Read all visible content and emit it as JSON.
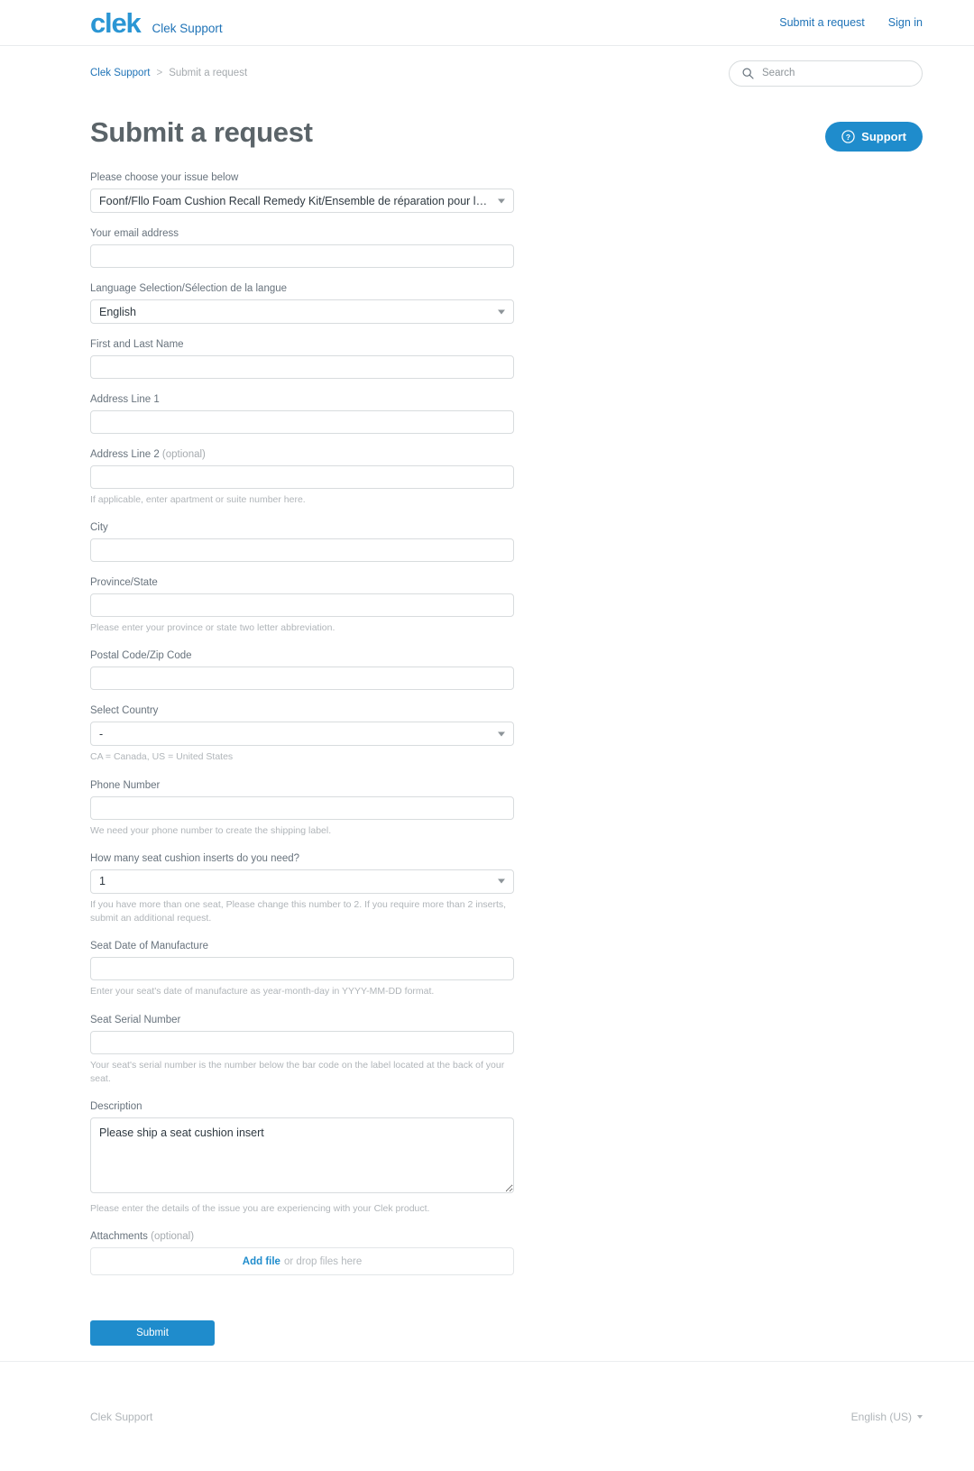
{
  "header": {
    "logo_text": "clek",
    "brand_name": "Clek Support",
    "nav": [
      {
        "label": "Submit a request"
      },
      {
        "label": "Sign in"
      }
    ]
  },
  "breadcrumb": {
    "root": "Clek Support",
    "separator": ">",
    "current": "Submit a request"
  },
  "search": {
    "placeholder": "Search",
    "icon": "search-icon"
  },
  "page": {
    "title": "Submit a request"
  },
  "support_fab": {
    "label": "Support",
    "icon": "question-circle-icon",
    "color": "#1f8ccc"
  },
  "form": {
    "issue": {
      "label": "Please choose your issue below",
      "value": "Foonf/Fllo Foam Cushion Recall Remedy Kit/Ensemble de réparation pour le rappel des ..."
    },
    "email": {
      "label": "Your email address",
      "value": ""
    },
    "language": {
      "label": "Language Selection/Sélection de la langue",
      "value": "English"
    },
    "name": {
      "label": "First and Last Name",
      "value": ""
    },
    "address1": {
      "label": "Address Line 1",
      "value": ""
    },
    "address2": {
      "label": "Address Line 2",
      "optional": "(optional)",
      "value": "",
      "hint": "If applicable, enter apartment or suite number here."
    },
    "city": {
      "label": "City",
      "value": ""
    },
    "province": {
      "label": "Province/State",
      "value": "",
      "hint": "Please enter your province or state two letter abbreviation."
    },
    "postal": {
      "label": "Postal Code/Zip Code",
      "value": ""
    },
    "country": {
      "label": "Select Country",
      "value": "-",
      "hint": "CA = Canada, US = United States"
    },
    "phone": {
      "label": "Phone Number",
      "value": "",
      "hint": "We need your phone number to create the shipping label."
    },
    "inserts": {
      "label": "How many seat cushion inserts do you need?",
      "value": "1",
      "hint": "If you have more than one seat, Please change this number to 2. If you require more than 2 inserts, submit an additional request."
    },
    "date_manufacture": {
      "label": "Seat Date of Manufacture",
      "value": "",
      "hint": "Enter your seat's date of manufacture as year-month-day in YYYY-MM-DD format."
    },
    "serial": {
      "label": "Seat Serial Number",
      "value": "",
      "hint": "Your seat's serial number is the number below the bar code on the label located at the back of your seat."
    },
    "description": {
      "label": "Description",
      "value": "Please ship a seat cushion insert",
      "hint": "Please enter the details of the issue you are experiencing with your Clek product."
    },
    "attachments": {
      "label": "Attachments",
      "optional": "(optional)",
      "add_file": "Add file",
      "drop_text": "or drop files here"
    },
    "submit": {
      "label": "Submit"
    }
  },
  "footer": {
    "brand": "Clek Support",
    "language": "English (US)"
  }
}
